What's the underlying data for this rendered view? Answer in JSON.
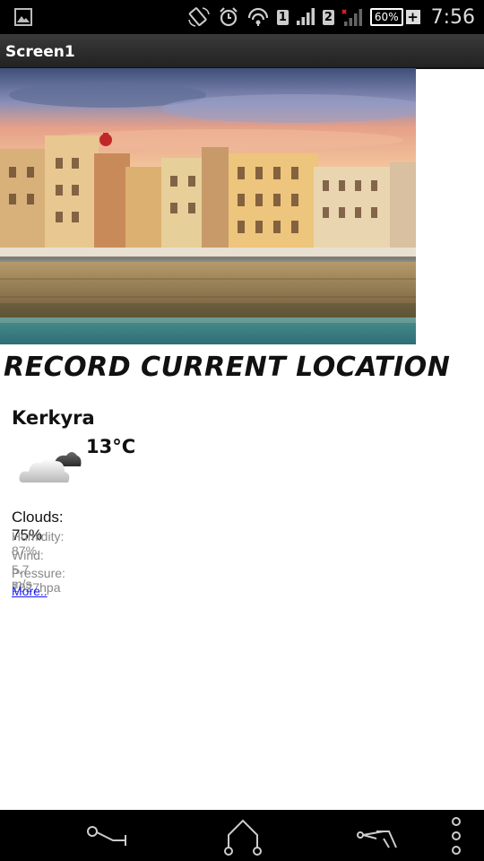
{
  "status_bar": {
    "sim1": "1",
    "sim2": "2",
    "battery": "60%",
    "battery_plus": "+",
    "clock": "7:56",
    "icons": [
      "image-notification-icon",
      "rotation-icon",
      "alarm-icon",
      "hotspot-icon",
      "signal-icon",
      "signal-no-data-icon",
      "battery-icon"
    ]
  },
  "app": {
    "title": "Screen1"
  },
  "main": {
    "heading": "RECORD CURRENT LOCATION"
  },
  "weather": {
    "city": "Kerkyra",
    "temperature": "13°C",
    "icon": "cloudy-icon",
    "clouds": "Clouds: 75%",
    "humidity": "Humidity: 87%",
    "wind": "Wind: 5.7 m/s",
    "pressure": "Pressure: 1027hpa",
    "more_link": "More.."
  },
  "nav_bar": {
    "icons": [
      "back-icon",
      "home-icon",
      "recent-apps-icon",
      "overflow-menu-icon"
    ]
  }
}
